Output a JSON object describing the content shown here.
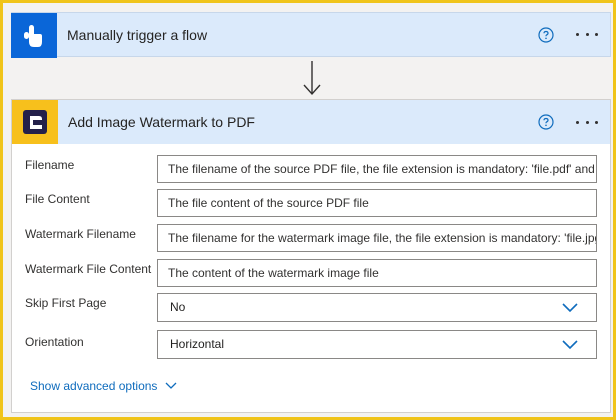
{
  "trigger": {
    "title": "Manually trigger a flow",
    "icon": "touch-hand-icon",
    "accent": "#0a66d8"
  },
  "action": {
    "title": "Add Image Watermark to PDF",
    "icon": "connector-logo-icon",
    "accent": "#f7c01c",
    "fields": [
      {
        "label": "Filename",
        "placeholder": "The filename of the source PDF file, the file extension is mandatory: 'file.pdf' and not 'file'"
      },
      {
        "label": "File Content",
        "placeholder": "The file content of the source PDF file"
      },
      {
        "label": "Watermark Filename",
        "placeholder": "The filename for the watermark image file, the file extension is mandatory: 'file.jpg' and not 'file'"
      },
      {
        "label": "Watermark File Content",
        "placeholder": "The content of the watermark image file"
      }
    ],
    "selects": [
      {
        "label": "Skip First Page",
        "value": "No"
      },
      {
        "label": "Orientation",
        "value": "Horizontal"
      }
    ],
    "advanced_label": "Show advanced options"
  },
  "colors": {
    "frame": "#f0c419",
    "header_bg": "#dbeafb",
    "link": "#0f6cbd"
  }
}
